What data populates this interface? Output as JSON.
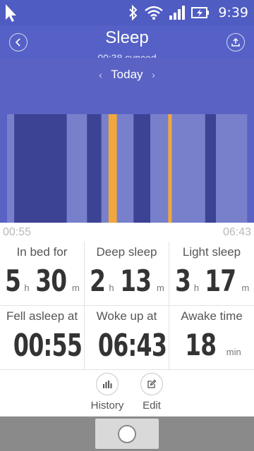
{
  "statusbar": {
    "time": "9:39"
  },
  "header": {
    "title": "Sleep",
    "subtitle": "00:38 synced"
  },
  "date_nav": {
    "label": "Today"
  },
  "timeline": {
    "start": "00:55",
    "end": "06:43",
    "colors": {
      "light": "#7880cc",
      "deep": "#3c4294",
      "awake": "#f2a73c"
    },
    "segments": [
      {
        "stage": "light",
        "minutes": 6
      },
      {
        "stage": "deep",
        "minutes": 44
      },
      {
        "stage": "light",
        "minutes": 17
      },
      {
        "stage": "deep",
        "minutes": 12
      },
      {
        "stage": "light",
        "minutes": 6
      },
      {
        "stage": "awake",
        "minutes": 7
      },
      {
        "stage": "light",
        "minutes": 14
      },
      {
        "stage": "deep",
        "minutes": 14
      },
      {
        "stage": "light",
        "minutes": 15
      },
      {
        "stage": "awake",
        "minutes": 3
      },
      {
        "stage": "light",
        "minutes": 28
      },
      {
        "stage": "deep",
        "minutes": 9
      },
      {
        "stage": "light",
        "minutes": 26
      }
    ]
  },
  "stats": {
    "in_bed": {
      "label": "In bed for",
      "hours": "5",
      "minutes": "30",
      "h_unit": "h",
      "m_unit": "m"
    },
    "deep": {
      "label": "Deep sleep",
      "hours": "2",
      "minutes": "13",
      "h_unit": "h",
      "m_unit": "m"
    },
    "light": {
      "label": "Light sleep",
      "hours": "3",
      "minutes": "17",
      "h_unit": "h",
      "m_unit": "m"
    },
    "fell_asleep": {
      "label": "Fell asleep at",
      "value": "00:55"
    },
    "woke_up": {
      "label": "Woke up at",
      "value": "06:43"
    },
    "awake": {
      "label": "Awake time",
      "value": "18",
      "unit": "min"
    }
  },
  "bottom_nav": {
    "history": "History",
    "edit": "Edit"
  }
}
